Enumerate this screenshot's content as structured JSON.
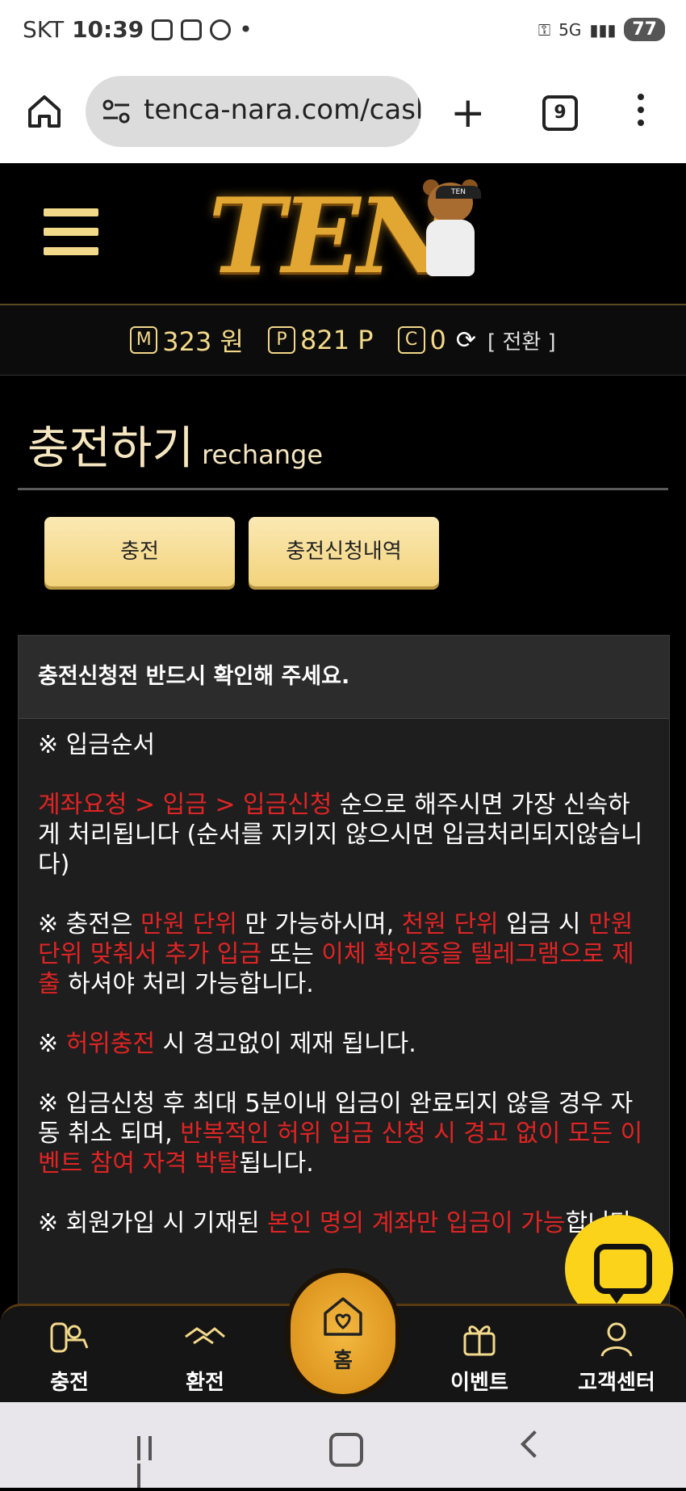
{
  "status_bar": {
    "carrier": "SKT",
    "time": "10:39",
    "network": "5G",
    "battery": "77"
  },
  "browser": {
    "url": "tenca-nara.com/casl",
    "tab_count": "9"
  },
  "site": {
    "logo_text": "TEN"
  },
  "balance": {
    "money_label": "M",
    "money": "323 원",
    "point_label": "P",
    "point": "821 P",
    "coin_label": "C",
    "coin": "0",
    "switch": "[ 전환 ]"
  },
  "page": {
    "title": "충전하기",
    "subtitle": "rechange"
  },
  "tabs": [
    {
      "label": "충전"
    },
    {
      "label": "충전신청내역"
    }
  ],
  "notice": {
    "heading": "충전신청전 반드시 확인해 주세요.",
    "p1": "※ 입금순서",
    "p2_red": "계좌요청 > 입금 > 입금신청",
    "p2_rest": " 순으로 해주시면 가장 신속하게 처리됩니다 (순서를 지키지 않으시면 입금처리되지않습니다)",
    "p3_a": "※ 충전은 ",
    "p3_b": "만원 단위",
    "p3_c": " 만 가능하시며, ",
    "p3_d": "천원 단위",
    "p3_e": " 입금 시 ",
    "p3_f": "만원 단위 맞춰서 추가 입금",
    "p3_g": " 또는 ",
    "p3_h": "이체 확인증을 텔레그램으로 제출",
    "p3_i": " 하셔야 처리 가능합니다.",
    "p4_a": "※ ",
    "p4_b": "허위충전",
    "p4_c": " 시 경고없이 제재 됩니다.",
    "p5_a": "※ 입금신청 후 최대 5분이내 입금이 완료되지 않을 경우 자동 취소 되며, ",
    "p5_b": "반복적인 허위 입금 신청 시 경고 없이 모든 이벤트 참여 자격 박탈",
    "p5_c": "됩니다.",
    "p6_a": "※ 회원가입 시 기재된 ",
    "p6_b": "본인 명의 계좌만 입금이 가능",
    "p6_c": "합니다."
  },
  "bottom_nav": [
    {
      "label": "충전",
      "icon": "hand-coin-icon"
    },
    {
      "label": "환전",
      "icon": "handshake-icon"
    },
    {
      "label": "홈",
      "icon": "home-heart-icon"
    },
    {
      "label": "이벤트",
      "icon": "gift-icon"
    },
    {
      "label": "고객센터",
      "icon": "support-agent-icon"
    }
  ],
  "colors": {
    "gold": "#f3d98a",
    "red": "#e02424",
    "chat_yellow": "#fbd31a"
  }
}
